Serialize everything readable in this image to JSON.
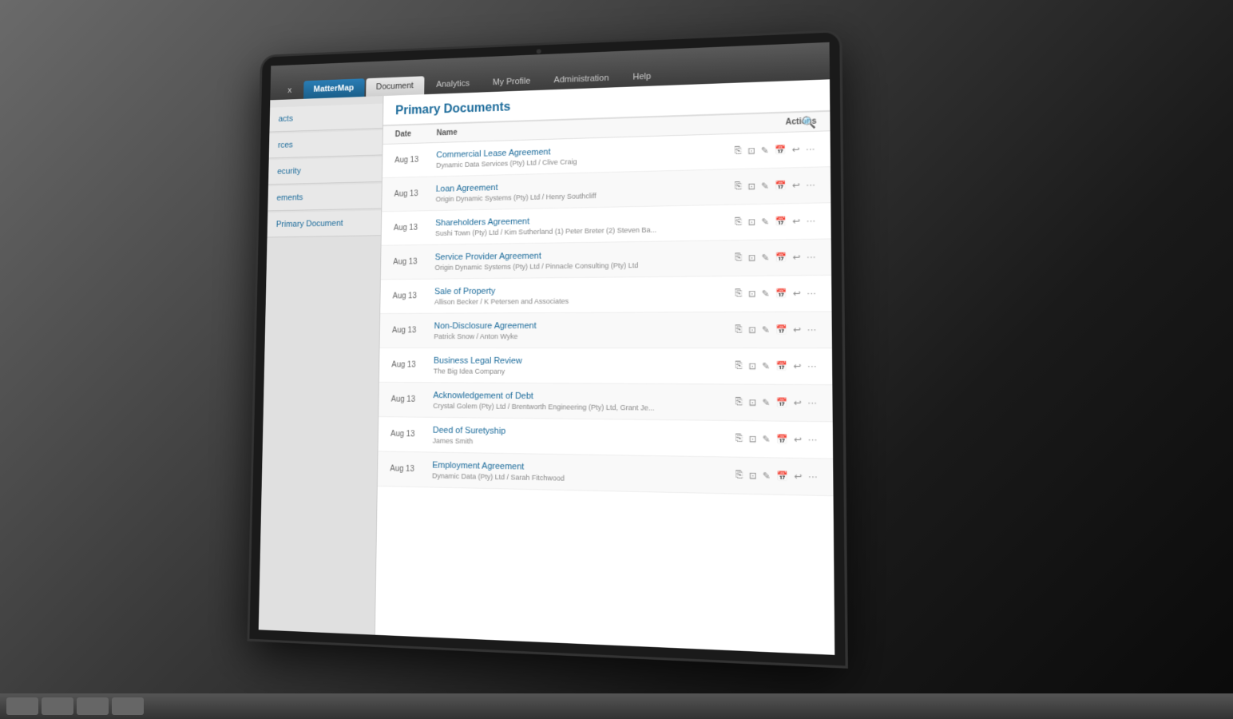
{
  "nav": {
    "tabs": [
      {
        "label": "x",
        "active": false
      },
      {
        "label": "MatterMap",
        "active": true
      },
      {
        "label": "Document",
        "active": false
      },
      {
        "label": "Analytics",
        "active": false
      },
      {
        "label": "My Profile",
        "active": false
      },
      {
        "label": "Administration",
        "active": false
      },
      {
        "label": "Help",
        "active": false
      }
    ]
  },
  "sidebar": {
    "items": [
      {
        "label": "acts",
        "type": "item"
      },
      {
        "label": "rces",
        "type": "item"
      },
      {
        "label": "ecurity",
        "type": "item"
      },
      {
        "label": "ements",
        "type": "item"
      },
      {
        "label": "Primary Document",
        "type": "item"
      }
    ]
  },
  "content": {
    "title": "Primary Documents",
    "columns": {
      "date": "Date",
      "name": "Name",
      "actions": "Actions"
    },
    "documents": [
      {
        "date": "Aug 13",
        "name": "Commercial Lease Agreement",
        "parties": "Dynamic Data Services (Pty) Ltd / Clive Craig",
        "linked": true
      },
      {
        "date": "Aug 13",
        "name": "Loan Agreement",
        "parties": "Origin Dynamic Systems (Pty) Ltd / Henry Southcliff",
        "linked": true
      },
      {
        "date": "Aug 13",
        "name": "Shareholders Agreement",
        "parties": "Sushi Town (Pty) Ltd / Kim Sutherland (1) Peter Breter (2) Steven Ba...",
        "linked": true
      },
      {
        "date": "Aug 13",
        "name": "Service Provider Agreement",
        "parties": "Origin Dynamic Systems (Pty) Ltd / Pinnacle Consulting (Pty) Ltd",
        "linked": true
      },
      {
        "date": "Aug 13",
        "name": "Sale of Property",
        "parties": "Allison Becker / K Petersen and Associates",
        "linked": true
      },
      {
        "date": "Aug 13",
        "name": "Non-Disclosure Agreement",
        "parties": "Patrick Snow / Anton Wyke",
        "linked": false
      },
      {
        "date": "Aug 13",
        "name": "Business Legal Review",
        "parties": "The Big Idea Company",
        "linked": true
      },
      {
        "date": "Aug 13",
        "name": "Acknowledgement of Debt",
        "parties": "Crystal Golem (Pty) Ltd / Brentworth Engineering (Pty) Ltd, Grant Je...",
        "linked": true
      },
      {
        "date": "Aug 13",
        "name": "Deed of Suretyship",
        "parties": "James Smith",
        "linked": false
      },
      {
        "date": "Aug 13",
        "name": "Employment Agreement",
        "parties": "Dynamic Data (Pty) Ltd / Sarah Fitchwood",
        "linked": true
      }
    ]
  },
  "icons": {
    "search": "🔍",
    "copy": "⎘",
    "download": "↓",
    "edit": "✎",
    "delete": "🗑",
    "share": "↩",
    "more": "···"
  }
}
